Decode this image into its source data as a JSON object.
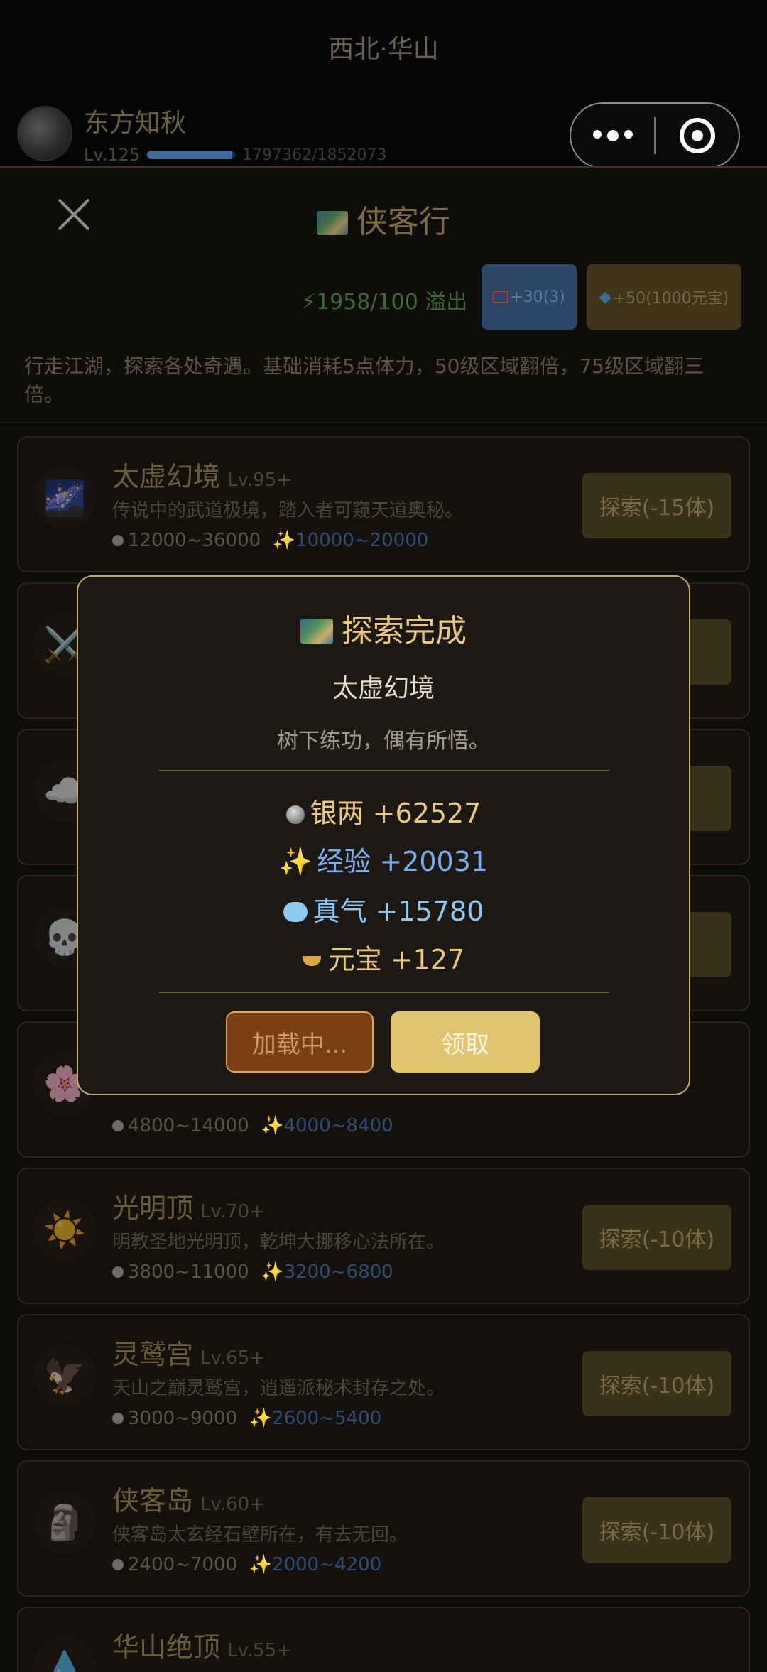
{
  "header": {
    "location": "西北·华山",
    "player_name": "东方知秋",
    "level": "Lv.125",
    "exp_text": "1797362/1852073",
    "exp_fraction": 0.97
  },
  "panel": {
    "title": "侠客行",
    "stamina": "⚡1958/100 溢出",
    "ad_button": "+30(3)",
    "gem_button": "+50(1000元宝)",
    "intro": "行走江湖，探索各处奇遇。基础消耗5点体力，50级区域翻倍，75级区域翻三倍。"
  },
  "areas": [
    {
      "icon": "🌌",
      "name": "太虚幻境",
      "lv": "Lv.95+",
      "desc": "传说中的武道极境，踏入者可窥天道奥秘。",
      "silver": "12000~36000",
      "exp": "10000~20000",
      "button": "探索(-15体)"
    },
    {
      "icon": "⚔️",
      "name": "",
      "lv": "",
      "desc": "",
      "silver": "",
      "exp": "",
      "button": "体)"
    },
    {
      "icon": "☁️",
      "name": "",
      "lv": "",
      "desc": "",
      "silver": "",
      "exp": "",
      "button": "体)"
    },
    {
      "icon": "💀",
      "name": "",
      "lv": "",
      "desc": "",
      "silver": "",
      "exp": "",
      "button": "体)"
    },
    {
      "icon": "🌸",
      "name": "",
      "lv": "",
      "desc": "",
      "silver": "4800~14000",
      "exp": "4000~8400",
      "button": ""
    },
    {
      "icon": "☀️",
      "name": "光明顶",
      "lv": "Lv.70+",
      "desc": "明教圣地光明顶，乾坤大挪移心法所在。",
      "silver": "3800~11000",
      "exp": "3200~6800",
      "button": "探索(-10体)"
    },
    {
      "icon": "🦅",
      "name": "灵鹫宫",
      "lv": "Lv.65+",
      "desc": "天山之巅灵鹫宫，逍遥派秘术封存之处。",
      "silver": "3000~9000",
      "exp": "2600~5400",
      "button": "探索(-10体)"
    },
    {
      "icon": "🗿",
      "name": "侠客岛",
      "lv": "Lv.60+",
      "desc": "侠客岛太玄经石壁所在，有去无回。",
      "silver": "2400~7000",
      "exp": "2000~4200",
      "button": "探索(-10体)"
    },
    {
      "icon": "💧",
      "name": "华山绝顶",
      "lv": "Lv.55+",
      "desc": "",
      "silver": "",
      "exp": "",
      "button": ""
    }
  ],
  "modal": {
    "title": "探索完成",
    "place": "太虚幻境",
    "desc": "树下练功，偶有所悟。",
    "rewards": {
      "silver": "银两 +62527",
      "exp": "经验 +20031",
      "qi": "真气 +15780",
      "yuanbao": "元宝 +127"
    },
    "loading_button": "加载中...",
    "claim_button": "领取"
  }
}
